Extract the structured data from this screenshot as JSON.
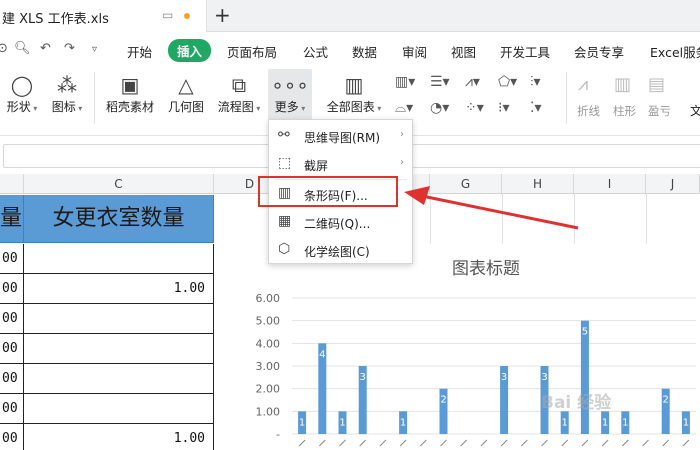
{
  "tab": {
    "title": "建 XLS 工作表.xls",
    "add": "+"
  },
  "menu": {
    "items": [
      {
        "label": "开始",
        "x": 127
      },
      {
        "label": "插入",
        "x": 168,
        "active": true
      },
      {
        "label": "页面布局",
        "x": 227
      },
      {
        "label": "公式",
        "x": 303
      },
      {
        "label": "数据",
        "x": 352
      },
      {
        "label": "审阅",
        "x": 402
      },
      {
        "label": "视图",
        "x": 451
      },
      {
        "label": "开发工具",
        "x": 500
      },
      {
        "label": "会员专享",
        "x": 574
      },
      {
        "label": "Excel服务",
        "x": 650
      }
    ]
  },
  "ribbon": {
    "shape": "形状",
    "icon_lib": "图标",
    "material": "稻壳素材",
    "geometry": "几何图",
    "flowchart": "流程图",
    "more": "更多",
    "all_charts": "全部图表",
    "sparkline_line": "折线",
    "sparkline_col": "柱形",
    "sparkline_wl": "盈亏",
    "text_cut": "文"
  },
  "dropdown": {
    "items": [
      {
        "label": "思维导图(RM)",
        "icon": "mindmap-icon",
        "submenu": true
      },
      {
        "label": "截屏",
        "icon": "screenshot-icon",
        "submenu": true
      },
      {
        "label": "条形码(F)...",
        "icon": "barcode-icon",
        "submenu": false
      },
      {
        "label": "二维码(Q)...",
        "icon": "qrcode-icon",
        "submenu": false
      },
      {
        "label": "化学绘图(C)",
        "icon": "chemistry-icon",
        "submenu": false
      }
    ]
  },
  "sheet": {
    "columns": [
      "C",
      "D",
      "G",
      "H",
      "I",
      "J"
    ],
    "header_b": "量",
    "header_c": "女更衣室数量",
    "rows": [
      {
        "b": "00",
        "c": ""
      },
      {
        "b": "00",
        "c": "1.00"
      },
      {
        "b": "00",
        "c": ""
      },
      {
        "b": "00",
        "c": ""
      },
      {
        "b": "00",
        "c": ""
      },
      {
        "b": "00",
        "c": ""
      },
      {
        "b": "00",
        "c": "1.00"
      }
    ]
  },
  "chart_data": {
    "type": "bar",
    "title": "图表标题",
    "ylim": [
      0,
      6
    ],
    "yticks": [
      "6.00",
      "5.00",
      "4.00",
      "3.00",
      "2.00",
      "1.00",
      "-"
    ],
    "categories": [
      "c1",
      "c2",
      "c3",
      "c4",
      "c5",
      "c6",
      "c7",
      "c8",
      "c9",
      "c10",
      "c11",
      "c12",
      "c13",
      "c14",
      "c15",
      "c16",
      "c17",
      "c18",
      "c19",
      "c20"
    ],
    "series": [
      {
        "values": [
          1,
          4,
          1,
          3,
          0,
          1,
          0,
          2,
          0,
          0,
          3,
          0,
          3,
          1,
          5,
          1,
          1,
          0,
          2,
          1
        ]
      }
    ],
    "bar_color": "#5b9bd5",
    "grid": true
  },
  "watermark": "Bai 经验"
}
